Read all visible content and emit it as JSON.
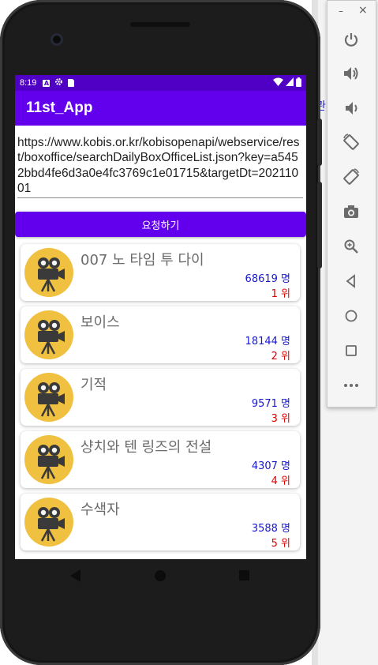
{
  "status_bar": {
    "time": "8:19"
  },
  "app_bar": {
    "title": "11st_App"
  },
  "request": {
    "url": "https://www.kobis.or.kr/kobisopenapi/webservice/rest/boxoffice/searchDailyBoxOfficeList.json?key=a5452bbd4fe6d3a0e4fc3769c1e01715&targetDt=20211001",
    "button_label": "요청하기"
  },
  "movies": [
    {
      "title": "007 노 타임 투 다이",
      "audience": "68619 명",
      "rank": "1 위"
    },
    {
      "title": "보이스",
      "audience": "18144 명",
      "rank": "2 위"
    },
    {
      "title": "기적",
      "audience": "9571 명",
      "rank": "3 위"
    },
    {
      "title": "샹치와 텐 링즈의 전설",
      "audience": "4307 명",
      "rank": "4 위"
    },
    {
      "title": "수색자",
      "audience": "3588 명",
      "rank": "5 위"
    }
  ],
  "emulator_panel": {
    "icons": [
      "power-icon",
      "volume-up-icon",
      "volume-down-icon",
      "rotate-left-icon",
      "rotate-right-icon",
      "camera-icon",
      "zoom-icon",
      "back-icon",
      "home-icon",
      "overview-icon",
      "more-icon"
    ]
  },
  "background": {
    "peek_text": "관"
  },
  "colors": {
    "primary": "#6200ee",
    "status_bar": "#4f00c4",
    "audience": "#1818d0",
    "rank": "#e00000",
    "poster": "#f0c040"
  }
}
